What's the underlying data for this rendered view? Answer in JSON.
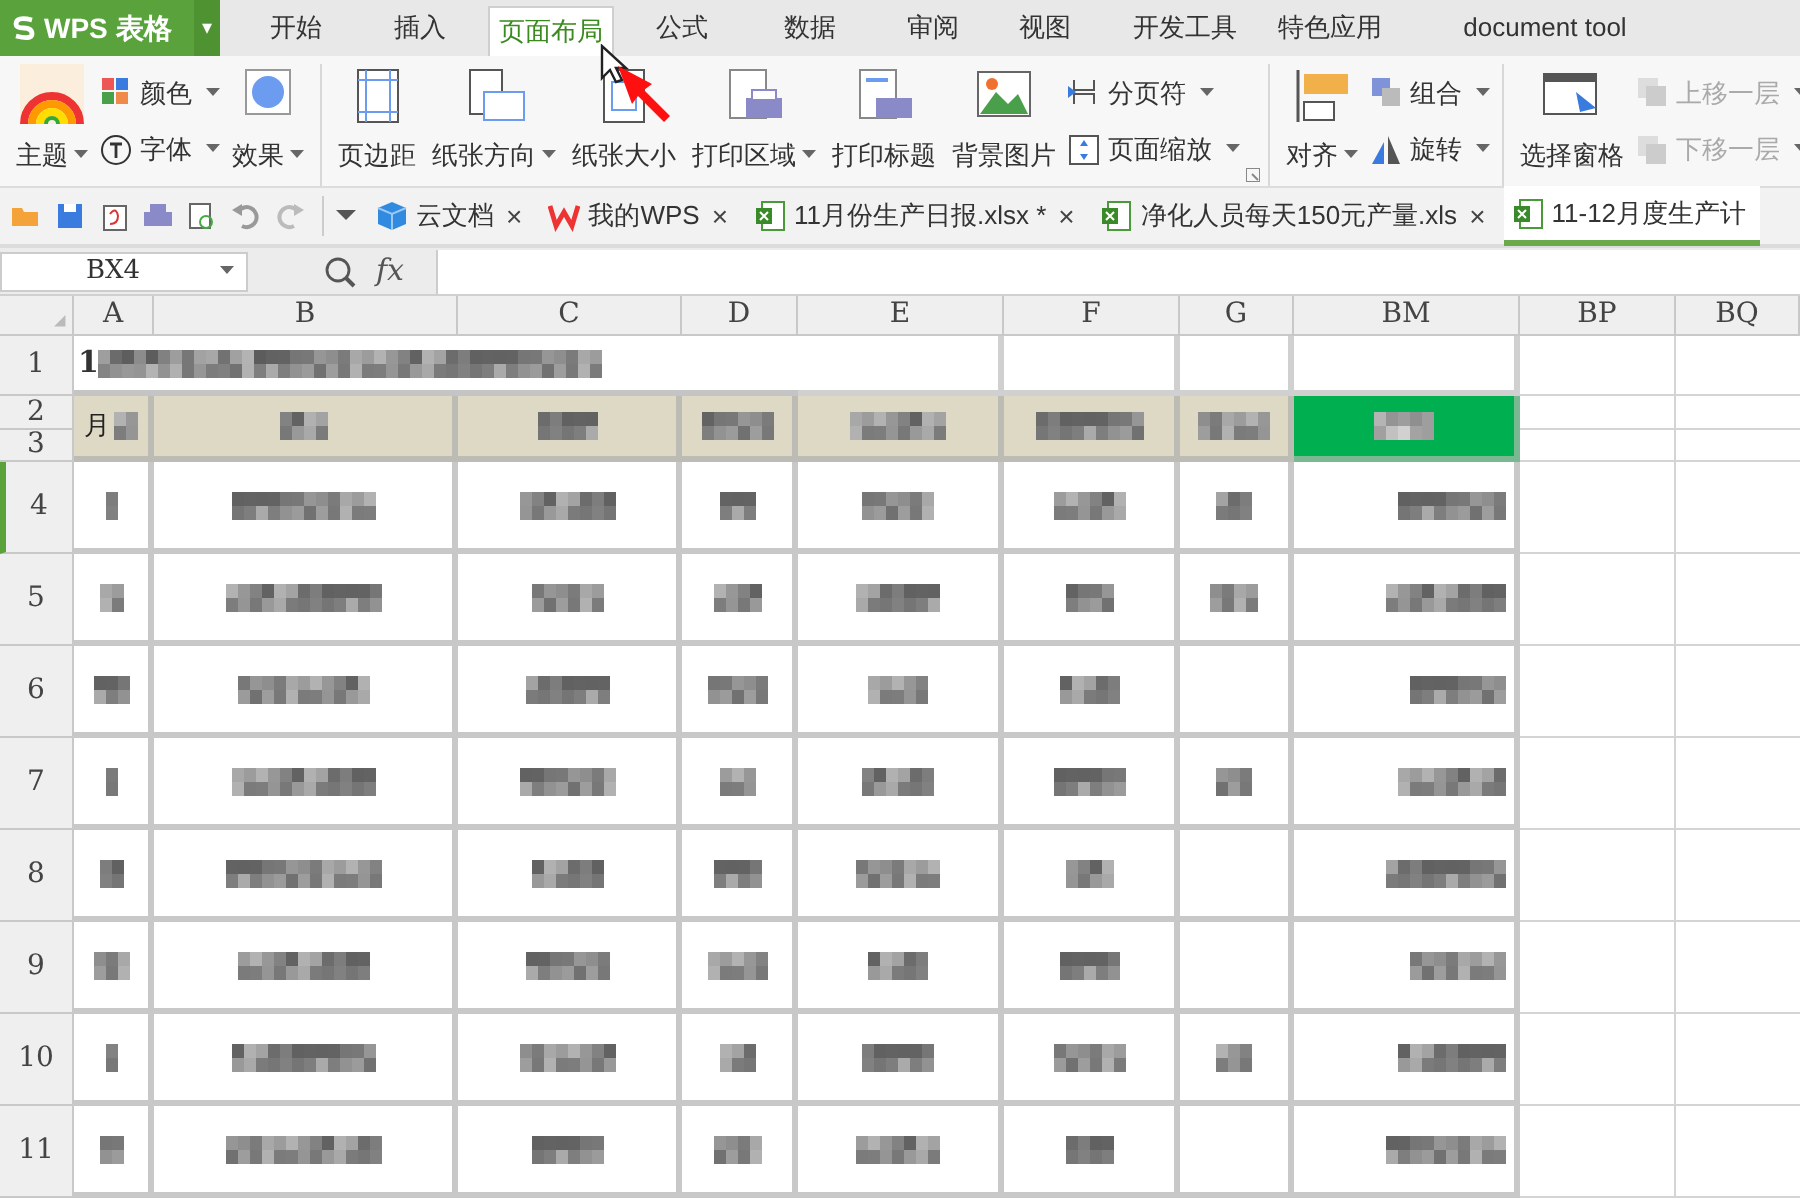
{
  "app_button": {
    "label": "WPS 表格",
    "dropdown": "▾"
  },
  "menu_tabs": [
    {
      "label": "开始",
      "selected": false
    },
    {
      "label": "插入",
      "selected": false
    },
    {
      "label": "页面布局",
      "selected": true
    },
    {
      "label": "公式",
      "selected": false
    },
    {
      "label": "数据",
      "selected": false
    },
    {
      "label": "审阅",
      "selected": false
    },
    {
      "label": "视图",
      "selected": false
    },
    {
      "label": "开发工具",
      "selected": false
    },
    {
      "label": "特色应用",
      "selected": false
    },
    {
      "label": "document tool",
      "selected": false
    }
  ],
  "ribbon_groups": [
    {
      "items": [
        {
          "kind": "large",
          "label": "主题",
          "dropdown": true,
          "disabled": false
        },
        {
          "kind": "stack",
          "items": [
            {
              "label": "颜色",
              "dropdown": true,
              "disabled": false
            },
            {
              "label": "字体",
              "dropdown": true,
              "disabled": false
            }
          ]
        },
        {
          "kind": "large",
          "label": "效果",
          "dropdown": true,
          "disabled": false
        }
      ]
    },
    {
      "items": [
        {
          "kind": "large",
          "label": "页边距",
          "dropdown": false,
          "disabled": false
        },
        {
          "kind": "large",
          "label": "纸张方向",
          "dropdown": true,
          "disabled": false
        },
        {
          "kind": "large",
          "label": "纸张大小",
          "dropdown": false,
          "disabled": false
        },
        {
          "kind": "large",
          "label": "打印区域",
          "dropdown": true,
          "disabled": false
        },
        {
          "kind": "large",
          "label": "打印标题",
          "dropdown": false,
          "disabled": false
        },
        {
          "kind": "large",
          "label": "背景图片",
          "dropdown": false,
          "disabled": false
        },
        {
          "kind": "stack",
          "items": [
            {
              "label": "分页符",
              "dropdown": true,
              "disabled": false
            },
            {
              "label": "页面缩放",
              "dropdown": true,
              "disabled": false
            }
          ]
        }
      ]
    },
    {
      "items": [
        {
          "kind": "large",
          "label": "对齐",
          "dropdown": true,
          "disabled": false
        },
        {
          "kind": "stack",
          "items": [
            {
              "label": "组合",
              "dropdown": true,
              "disabled": false
            },
            {
              "label": "旋转",
              "dropdown": true,
              "disabled": false
            }
          ]
        }
      ]
    },
    {
      "items": [
        {
          "kind": "large",
          "label": "选择窗格",
          "dropdown": false,
          "disabled": false
        },
        {
          "kind": "stack",
          "items": [
            {
              "label": "上移一层",
              "dropdown": true,
              "disabled": true
            },
            {
              "label": "下移一层",
              "dropdown": true,
              "disabled": true
            }
          ]
        }
      ]
    }
  ],
  "doc_tabs": [
    {
      "label": "云文档",
      "kind": "cloud",
      "selected": false
    },
    {
      "label": "我的WPS",
      "kind": "wps",
      "selected": false
    },
    {
      "label": "11月份生产日报.xlsx *",
      "kind": "sheet",
      "selected": false
    },
    {
      "label": "净化人员每天150元产量.xls",
      "kind": "sheet",
      "selected": false
    },
    {
      "label": "11-12月度生产计",
      "kind": "sheet",
      "selected": true
    }
  ],
  "tab_close": "×",
  "formula_bar": {
    "name_box": "BX4",
    "fx": "fx"
  },
  "columns": [
    {
      "label": "A"
    },
    {
      "label": "B"
    },
    {
      "label": "C"
    },
    {
      "label": "D"
    },
    {
      "label": "E"
    },
    {
      "label": "F"
    },
    {
      "label": "G"
    },
    {
      "label": "BM"
    },
    {
      "label": "BP"
    },
    {
      "label": "BQ"
    }
  ],
  "title_row": {
    "header": "1",
    "text": "1"
  },
  "header_rows": {
    "headers": [
      "2",
      "3"
    ],
    "first_cell": "月"
  },
  "rows": [
    {
      "header": "4",
      "selected": true,
      "cells": [
        {
          "blurred": true
        },
        {
          "blurred": true
        },
        {
          "blurred": true
        },
        {
          "blurred": true
        },
        {
          "blurred": true
        },
        {
          "blurred": true
        },
        {
          "blurred": true
        },
        {
          "blurred": true
        }
      ]
    },
    {
      "header": "5",
      "selected": false,
      "cells": [
        {
          "blurred": true
        },
        {
          "blurred": true
        },
        {
          "blurred": true
        },
        {
          "blurred": true
        },
        {
          "blurred": true
        },
        {
          "blurred": true
        },
        {
          "blurred": true
        },
        {
          "blurred": true
        }
      ]
    },
    {
      "header": "6",
      "selected": false,
      "cells": [
        {
          "blurred": true
        },
        {
          "blurred": true
        },
        {
          "blurred": true
        },
        {
          "blurred": true
        },
        {
          "blurred": true
        },
        {
          "blurred": true
        },
        {
          "blurred": false
        },
        {
          "blurred": true
        }
      ]
    },
    {
      "header": "7",
      "selected": false,
      "cells": [
        {
          "blurred": true
        },
        {
          "blurred": true
        },
        {
          "blurred": true
        },
        {
          "blurred": true
        },
        {
          "blurred": true
        },
        {
          "blurred": true
        },
        {
          "blurred": true
        },
        {
          "blurred": true
        }
      ]
    },
    {
      "header": "8",
      "selected": false,
      "cells": [
        {
          "blurred": true
        },
        {
          "blurred": true
        },
        {
          "blurred": true
        },
        {
          "blurred": true
        },
        {
          "blurred": true
        },
        {
          "blurred": true
        },
        {
          "blurred": false
        },
        {
          "blurred": true
        }
      ]
    },
    {
      "header": "9",
      "selected": false,
      "cells": [
        {
          "blurred": true
        },
        {
          "blurred": true
        },
        {
          "blurred": true
        },
        {
          "blurred": true
        },
        {
          "blurred": true
        },
        {
          "blurred": true
        },
        {
          "blurred": false
        },
        {
          "blurred": true
        }
      ]
    },
    {
      "header": "10",
      "selected": false,
      "cells": [
        {
          "blurred": true
        },
        {
          "blurred": true
        },
        {
          "blurred": true
        },
        {
          "blurred": true
        },
        {
          "blurred": true
        },
        {
          "blurred": true
        },
        {
          "blurred": true
        },
        {
          "blurred": true
        }
      ]
    },
    {
      "header": "11",
      "selected": false,
      "cells": [
        {
          "blurred": true
        },
        {
          "blurred": true
        },
        {
          "blurred": true
        },
        {
          "blurred": true
        },
        {
          "blurred": true
        },
        {
          "blurred": true
        },
        {
          "blurred": false
        },
        {
          "blurred": true
        }
      ]
    }
  ]
}
